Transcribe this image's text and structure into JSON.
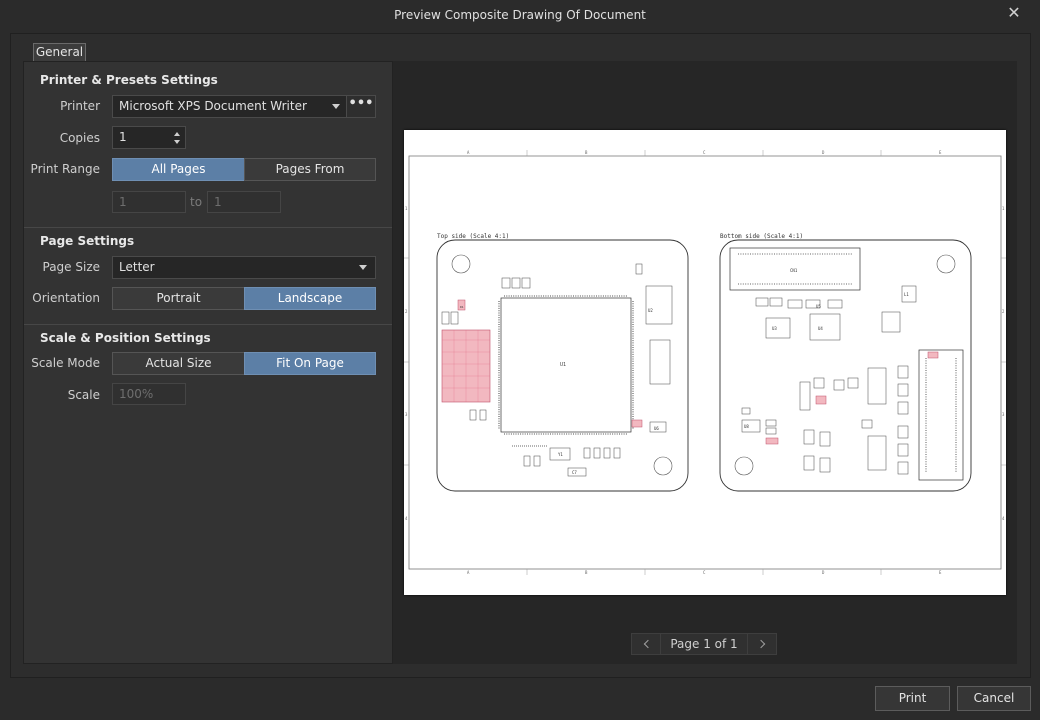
{
  "window": {
    "title": "Preview Composite Drawing Of Document"
  },
  "tabs": [
    {
      "label": "General"
    }
  ],
  "printer_presets": {
    "title": "Printer & Presets Settings",
    "printer_label": "Printer",
    "printer_value": "Microsoft XPS Document Writer",
    "more_label": "•••",
    "copies_label": "Copies",
    "copies_value": "1",
    "print_range_label": "Print Range",
    "range_options": [
      "All Pages",
      "Pages From"
    ],
    "range_selected": "All Pages",
    "from_value": "1",
    "to_label": "to",
    "to_value": "1"
  },
  "page_settings": {
    "title": "Page Settings",
    "page_size_label": "Page Size",
    "page_size_value": "Letter",
    "orientation_label": "Orientation",
    "orientation_options": [
      "Portrait",
      "Landscape"
    ],
    "orientation_selected": "Landscape"
  },
  "scale_position": {
    "title": "Scale & Position Settings",
    "scale_mode_label": "Scale Mode",
    "scale_mode_options": [
      "Actual Size",
      "Fit On Page"
    ],
    "scale_mode_selected": "Fit On Page",
    "scale_label": "Scale",
    "scale_placeholder": "100%"
  },
  "preview": {
    "top_label": "Top side (Scale 4:1)",
    "bottom_label": "Bottom side (Scale 4:1)",
    "col_marks": [
      "A",
      "B",
      "C",
      "D",
      "E"
    ],
    "row_marks": [
      "1",
      "2",
      "3",
      "4"
    ],
    "components_top": [
      "U1",
      "U2",
      "Y1",
      "C7",
      "U6",
      "D1"
    ],
    "components_bottom": [
      "CN1",
      "U3",
      "U4",
      "U5",
      "L1",
      "U8"
    ]
  },
  "pager": {
    "label": "Page 1 of 1"
  },
  "footer": {
    "print_label": "Print",
    "cancel_label": "Cancel"
  },
  "colors": {
    "accent": "#5c7fa6",
    "highlight_red": "#e06070"
  }
}
